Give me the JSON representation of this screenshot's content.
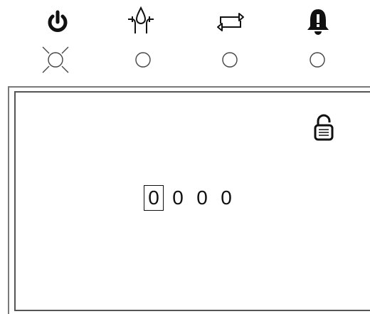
{
  "indicators": [
    {
      "icon": "power-icon",
      "led": "on"
    },
    {
      "icon": "water-valve-icon",
      "led": "off"
    },
    {
      "icon": "cycle-arrows-icon",
      "led": "off"
    },
    {
      "icon": "alarm-bell-icon",
      "led": "off"
    }
  ],
  "lock": {
    "icon": "padlock-open-icon"
  },
  "code": {
    "digits": [
      "0",
      "0",
      "0",
      "0"
    ],
    "selected_index": 0
  },
  "colors": {
    "stroke": "#111111",
    "led_outline": "#444444"
  }
}
